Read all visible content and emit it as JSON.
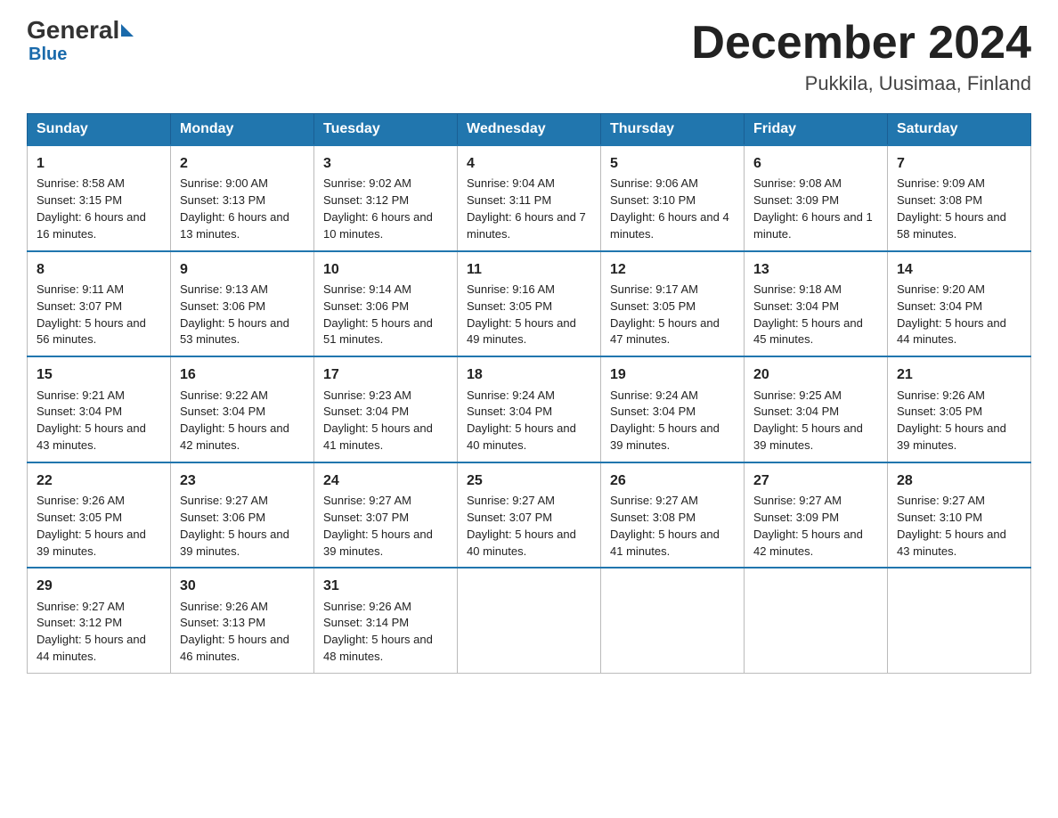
{
  "logo": {
    "general": "General",
    "blue": "Blue"
  },
  "title": "December 2024",
  "location": "Pukkila, Uusimaa, Finland",
  "days": [
    "Sunday",
    "Monday",
    "Tuesday",
    "Wednesday",
    "Thursday",
    "Friday",
    "Saturday"
  ],
  "weeks": [
    [
      {
        "num": "1",
        "sunrise": "8:58 AM",
        "sunset": "3:15 PM",
        "daylight": "6 hours and 16 minutes."
      },
      {
        "num": "2",
        "sunrise": "9:00 AM",
        "sunset": "3:13 PM",
        "daylight": "6 hours and 13 minutes."
      },
      {
        "num": "3",
        "sunrise": "9:02 AM",
        "sunset": "3:12 PM",
        "daylight": "6 hours and 10 minutes."
      },
      {
        "num": "4",
        "sunrise": "9:04 AM",
        "sunset": "3:11 PM",
        "daylight": "6 hours and 7 minutes."
      },
      {
        "num": "5",
        "sunrise": "9:06 AM",
        "sunset": "3:10 PM",
        "daylight": "6 hours and 4 minutes."
      },
      {
        "num": "6",
        "sunrise": "9:08 AM",
        "sunset": "3:09 PM",
        "daylight": "6 hours and 1 minute."
      },
      {
        "num": "7",
        "sunrise": "9:09 AM",
        "sunset": "3:08 PM",
        "daylight": "5 hours and 58 minutes."
      }
    ],
    [
      {
        "num": "8",
        "sunrise": "9:11 AM",
        "sunset": "3:07 PM",
        "daylight": "5 hours and 56 minutes."
      },
      {
        "num": "9",
        "sunrise": "9:13 AM",
        "sunset": "3:06 PM",
        "daylight": "5 hours and 53 minutes."
      },
      {
        "num": "10",
        "sunrise": "9:14 AM",
        "sunset": "3:06 PM",
        "daylight": "5 hours and 51 minutes."
      },
      {
        "num": "11",
        "sunrise": "9:16 AM",
        "sunset": "3:05 PM",
        "daylight": "5 hours and 49 minutes."
      },
      {
        "num": "12",
        "sunrise": "9:17 AM",
        "sunset": "3:05 PM",
        "daylight": "5 hours and 47 minutes."
      },
      {
        "num": "13",
        "sunrise": "9:18 AM",
        "sunset": "3:04 PM",
        "daylight": "5 hours and 45 minutes."
      },
      {
        "num": "14",
        "sunrise": "9:20 AM",
        "sunset": "3:04 PM",
        "daylight": "5 hours and 44 minutes."
      }
    ],
    [
      {
        "num": "15",
        "sunrise": "9:21 AM",
        "sunset": "3:04 PM",
        "daylight": "5 hours and 43 minutes."
      },
      {
        "num": "16",
        "sunrise": "9:22 AM",
        "sunset": "3:04 PM",
        "daylight": "5 hours and 42 minutes."
      },
      {
        "num": "17",
        "sunrise": "9:23 AM",
        "sunset": "3:04 PM",
        "daylight": "5 hours and 41 minutes."
      },
      {
        "num": "18",
        "sunrise": "9:24 AM",
        "sunset": "3:04 PM",
        "daylight": "5 hours and 40 minutes."
      },
      {
        "num": "19",
        "sunrise": "9:24 AM",
        "sunset": "3:04 PM",
        "daylight": "5 hours and 39 minutes."
      },
      {
        "num": "20",
        "sunrise": "9:25 AM",
        "sunset": "3:04 PM",
        "daylight": "5 hours and 39 minutes."
      },
      {
        "num": "21",
        "sunrise": "9:26 AM",
        "sunset": "3:05 PM",
        "daylight": "5 hours and 39 minutes."
      }
    ],
    [
      {
        "num": "22",
        "sunrise": "9:26 AM",
        "sunset": "3:05 PM",
        "daylight": "5 hours and 39 minutes."
      },
      {
        "num": "23",
        "sunrise": "9:27 AM",
        "sunset": "3:06 PM",
        "daylight": "5 hours and 39 minutes."
      },
      {
        "num": "24",
        "sunrise": "9:27 AM",
        "sunset": "3:07 PM",
        "daylight": "5 hours and 39 minutes."
      },
      {
        "num": "25",
        "sunrise": "9:27 AM",
        "sunset": "3:07 PM",
        "daylight": "5 hours and 40 minutes."
      },
      {
        "num": "26",
        "sunrise": "9:27 AM",
        "sunset": "3:08 PM",
        "daylight": "5 hours and 41 minutes."
      },
      {
        "num": "27",
        "sunrise": "9:27 AM",
        "sunset": "3:09 PM",
        "daylight": "5 hours and 42 minutes."
      },
      {
        "num": "28",
        "sunrise": "9:27 AM",
        "sunset": "3:10 PM",
        "daylight": "5 hours and 43 minutes."
      }
    ],
    [
      {
        "num": "29",
        "sunrise": "9:27 AM",
        "sunset": "3:12 PM",
        "daylight": "5 hours and 44 minutes."
      },
      {
        "num": "30",
        "sunrise": "9:26 AM",
        "sunset": "3:13 PM",
        "daylight": "5 hours and 46 minutes."
      },
      {
        "num": "31",
        "sunrise": "9:26 AM",
        "sunset": "3:14 PM",
        "daylight": "5 hours and 48 minutes."
      },
      null,
      null,
      null,
      null
    ]
  ]
}
